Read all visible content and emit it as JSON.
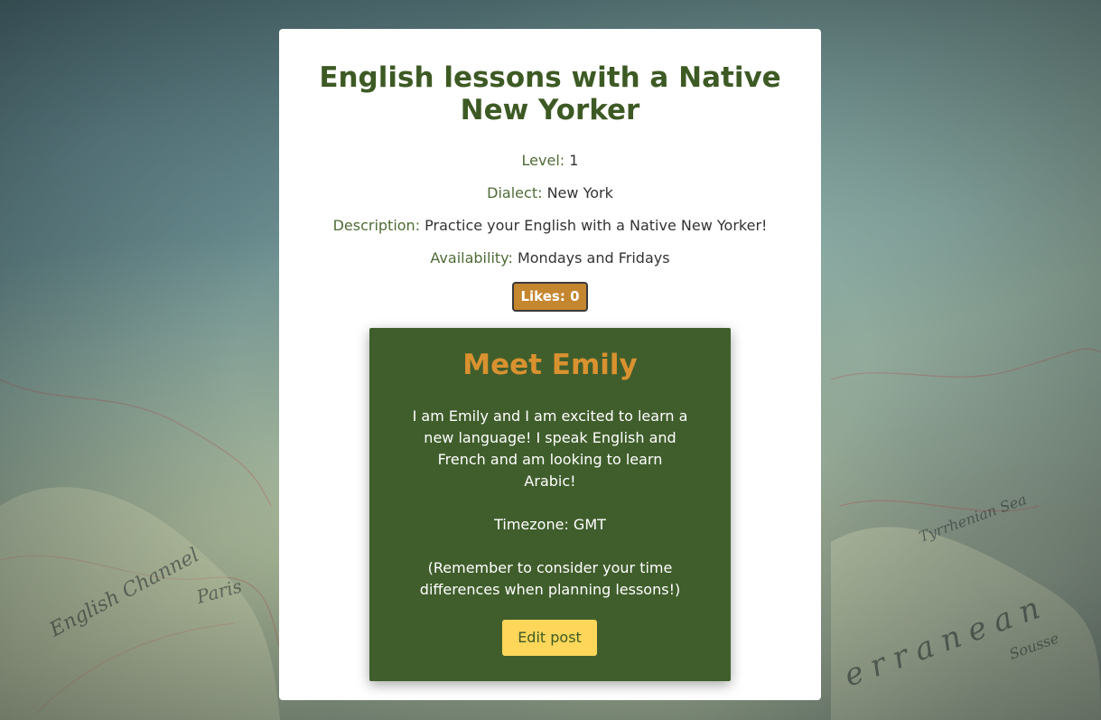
{
  "post": {
    "title": "English lessons with a Native New Yorker",
    "level_label": "Level:",
    "level_value": "1",
    "dialect_label": "Dialect:",
    "dialect_value": "New York",
    "description_label": "Description:",
    "description_value": "Practice your English with a Native New Yorker!",
    "availability_label": "Availability:",
    "availability_value": "Mondays and Fridays",
    "likes_label": "Likes: 0"
  },
  "profile": {
    "title": "Meet Emily",
    "bio": "I am Emily and I am excited to learn a new language! I speak English and French and am looking to learn Arabic!",
    "timezone": "Timezone: GMT",
    "reminder": "(Remember to consider your time differences when planning lessons!)",
    "edit_label": "Edit post"
  },
  "colors": {
    "title_green": "#3d5a24",
    "profile_bg": "#405e2c",
    "profile_title": "#d9922f",
    "likes_bg": "#c4862f",
    "edit_bg": "#fdd65a"
  }
}
